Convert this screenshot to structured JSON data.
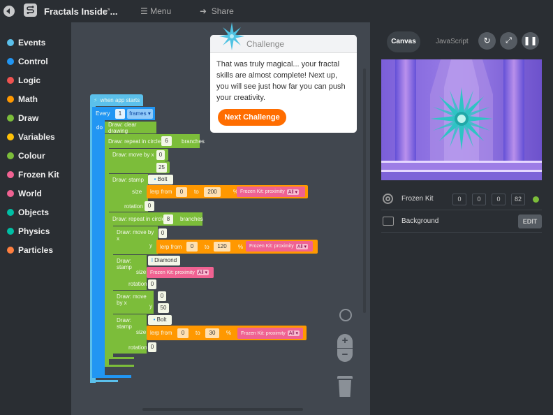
{
  "topbar": {
    "title": "Fractals Inside ...",
    "menu_label": "Menu",
    "share_label": "Share"
  },
  "sidebar": {
    "categories": [
      {
        "label": "Events",
        "color": "#5bc0eb"
      },
      {
        "label": "Control",
        "color": "#2196f3"
      },
      {
        "label": "Logic",
        "color": "#ef5350"
      },
      {
        "label": "Math",
        "color": "#ff9800"
      },
      {
        "label": "Draw",
        "color": "#7cbd3a"
      },
      {
        "label": "Variables",
        "color": "#ffc107"
      },
      {
        "label": "Colour",
        "color": "#7cbd3a"
      },
      {
        "label": "Frozen Kit",
        "color": "#f06292"
      },
      {
        "label": "World",
        "color": "#f06292"
      },
      {
        "label": "Objects",
        "color": "#00bfa5"
      },
      {
        "label": "Physics",
        "color": "#00bfa5"
      },
      {
        "label": "Particles",
        "color": "#ff7f3f"
      }
    ]
  },
  "challenge": {
    "header": "Challenge",
    "body": "That was truly magical... your fractal skills are almost complete! Next up, you will see just how far you can push your creativity.",
    "button_label": "Next Challenge"
  },
  "blocks": {
    "when_app_starts": "when app starts",
    "every": "Every",
    "every_value": "1",
    "frames": "frames",
    "do": "do",
    "clear_drawing": "Draw: clear drawing",
    "repeat1": "Draw: repeat in circle",
    "repeat1_value": "6",
    "branches": "branches",
    "move1": "Draw: move by x",
    "move1_x": "0",
    "y": "y",
    "move1_y": "25",
    "stamp1": "Draw: stamp",
    "stamp1_shape": "Bolt",
    "size": "size",
    "lerp_from": "lerp from",
    "to": "to",
    "percent": "%",
    "lerp1_from": "0",
    "lerp1_to": "200",
    "proximity": "Frozen Kit: proximity",
    "all": "All",
    "rotation": "rotation",
    "stamp1_rotation": "0",
    "repeat2": "Draw: repeat in circle",
    "repeat2_value": "8",
    "move2": "Draw: move by x",
    "move2_x": "0",
    "lerp2_from": "0",
    "lerp2_to": "120",
    "stamp2": "Draw: stamp",
    "stamp2_shape": "Diamond",
    "stamp2_rotation": "0",
    "move3": "Draw: move by x",
    "move3_x": "0",
    "move3_y": "50",
    "stamp3": "Draw: stamp",
    "stamp3_shape": "Bolt",
    "lerp3_from": "0",
    "lerp3_to": "30",
    "stamp3_rotation": "0"
  },
  "right_panel": {
    "tab_canvas": "Canvas",
    "tab_js": "JavaScript",
    "objects": [
      {
        "name": "Frozen Kit",
        "values": [
          "0",
          "0",
          "0",
          "82"
        ],
        "status_color": "#7cbd3a"
      },
      {
        "name": "Background",
        "button": "EDIT"
      }
    ]
  }
}
